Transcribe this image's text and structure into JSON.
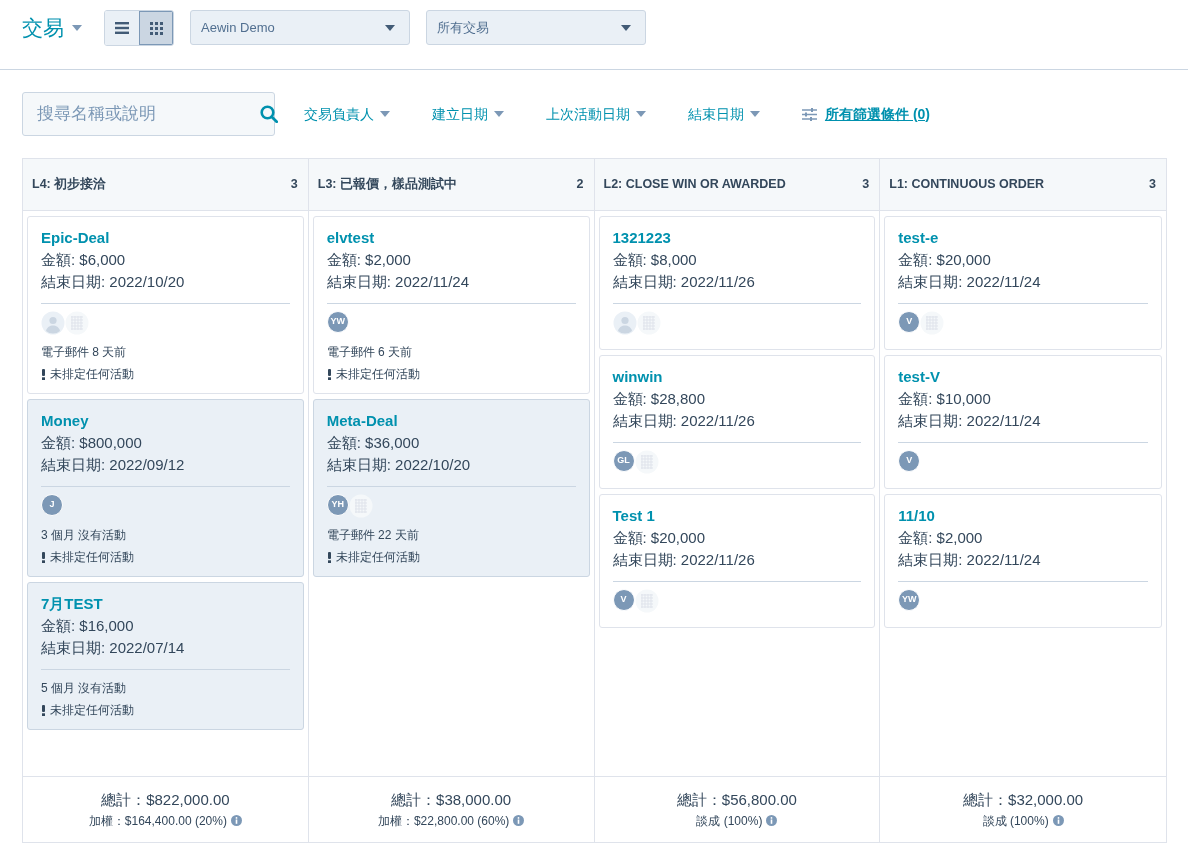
{
  "header": {
    "title": "交易",
    "view_toggle": [
      {
        "kind": "list",
        "selected": false
      },
      {
        "kind": "grid",
        "selected": true
      }
    ],
    "pipeline_select": "Aewin Demo",
    "deal_select": "所有交易"
  },
  "filters": {
    "search_placeholder": "搜尋名稱或說明",
    "dropdowns": [
      "交易負責人",
      "建立日期",
      "上次活動日期",
      "結束日期"
    ],
    "all_filters": "所有篩選條件 (0)"
  },
  "columns": [
    {
      "title": "L4: 初步接洽",
      "count": "3",
      "total": "總計：$822,000.00",
      "weighted": "加權：$164,400.00 (20%)",
      "cards": [
        {
          "name": "Epic-Deal",
          "amount": "金額: $6,000",
          "close_date": "結束日期: 2022/10/20",
          "stale": false,
          "avatars": [
            {
              "kind": "contact"
            },
            {
              "kind": "company"
            }
          ],
          "activity": "電子郵件 8 天前",
          "next": "未排定任何活動"
        },
        {
          "name": "Money",
          "amount": "金額: $800,000",
          "close_date": "結束日期: 2022/09/12",
          "stale": true,
          "avatars": [
            {
              "kind": "owner",
              "initials": "J"
            }
          ],
          "activity": "3 個月 沒有活動",
          "next": "未排定任何活動"
        },
        {
          "name": "7月TEST",
          "amount": "金額: $16,000",
          "close_date": "結束日期: 2022/07/14",
          "stale": true,
          "activity": "5 個月 沒有活動",
          "next": "未排定任何活動"
        }
      ]
    },
    {
      "title": "L3: 已報價，樣品測試中",
      "count": "2",
      "total": "總計：$38,000.00",
      "weighted": "加權：$22,800.00 (60%)",
      "cards": [
        {
          "name": "elvtest",
          "amount": "金額: $2,000",
          "close_date": "結束日期: 2022/11/24",
          "stale": false,
          "avatars": [
            {
              "kind": "owner",
              "initials": "YW"
            }
          ],
          "activity": "電子郵件 6 天前",
          "next": "未排定任何活動"
        },
        {
          "name": "Meta-Deal",
          "amount": "金額: $36,000",
          "close_date": "結束日期: 2022/10/20",
          "stale": true,
          "avatars": [
            {
              "kind": "owner",
              "initials": "YH"
            },
            {
              "kind": "company"
            }
          ],
          "activity": "電子郵件 22 天前",
          "next": "未排定任何活動"
        }
      ]
    },
    {
      "title": "L2: CLOSE WIN OR AWARDED",
      "count": "3",
      "total": "總計：$56,800.00",
      "weighted": "談成 (100%)",
      "cards": [
        {
          "name": "1321223",
          "amount": "金額: $8,000",
          "close_date": "結束日期: 2022/11/26",
          "stale": false,
          "avatars": [
            {
              "kind": "contact"
            },
            {
              "kind": "company"
            }
          ]
        },
        {
          "name": "winwin",
          "amount": "金額: $28,800",
          "close_date": "結束日期: 2022/11/26",
          "stale": false,
          "avatars": [
            {
              "kind": "owner",
              "initials": "GL"
            },
            {
              "kind": "company"
            }
          ]
        },
        {
          "name": "Test 1",
          "amount": "金額: $20,000",
          "close_date": "結束日期: 2022/11/26",
          "stale": false,
          "avatars": [
            {
              "kind": "owner",
              "initials": "V"
            },
            {
              "kind": "company"
            }
          ]
        }
      ]
    },
    {
      "title": "L1: CONTINUOUS ORDER",
      "count": "3",
      "total": "總計：$32,000.00",
      "weighted": "談成 (100%)",
      "cards": [
        {
          "name": "test-e",
          "amount": "金額: $20,000",
          "close_date": "結束日期: 2022/11/24",
          "stale": false,
          "avatars": [
            {
              "kind": "owner",
              "initials": "V"
            },
            {
              "kind": "company"
            }
          ]
        },
        {
          "name": "test-V",
          "amount": "金額: $10,000",
          "close_date": "結束日期: 2022/11/24",
          "stale": false,
          "avatars": [
            {
              "kind": "owner",
              "initials": "V"
            }
          ]
        },
        {
          "name": "11/10",
          "amount": "金額: $2,000",
          "close_date": "結束日期: 2022/11/24",
          "stale": false,
          "avatars": [
            {
              "kind": "owner",
              "initials": "YW"
            }
          ]
        }
      ]
    }
  ]
}
